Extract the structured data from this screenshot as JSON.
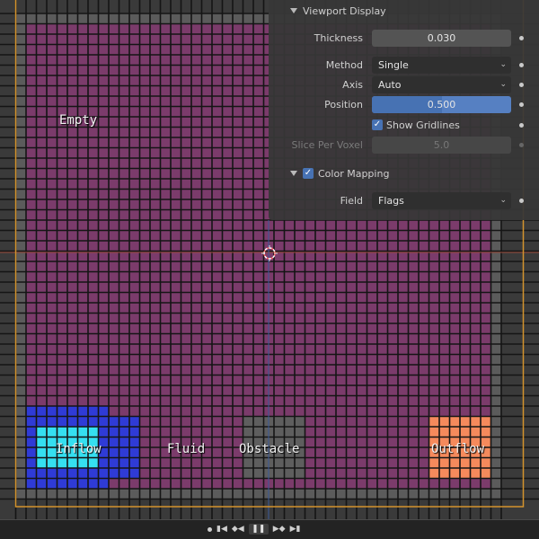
{
  "panel": {
    "title": "Viewport Display",
    "thickness": {
      "label": "Thickness",
      "value": "0.030"
    },
    "method": {
      "label": "Method",
      "value": "Single"
    },
    "axis": {
      "label": "Axis",
      "value": "Auto"
    },
    "position": {
      "label": "Position",
      "value": "0.500",
      "fraction": 0.5
    },
    "show_gridlines": {
      "label": "Show Gridlines",
      "checked": true
    },
    "slice_per_voxel": {
      "label": "Slice Per Voxel",
      "value": "5.0",
      "disabled": true
    },
    "color_mapping": {
      "label": "Color Mapping",
      "checked": true
    },
    "field": {
      "label": "Field",
      "value": "Flags"
    }
  },
  "cell_labels": {
    "empty": "Empty",
    "inflow": "Inflow",
    "fluid": "Fluid",
    "obstacle": "Obstacle",
    "outflow": "Outflow"
  },
  "colors": {
    "empty": "#7b3b6b",
    "fluid": "#7b3b6b",
    "boundary": "#5b5b5b",
    "inflow_outer": "#2f3bd6",
    "inflow_inner": "#35dff0",
    "obstacle": "#5e5e5e",
    "outflow": "#f58a5c",
    "selection_border": "#d4932d"
  },
  "timeline": {
    "icons": [
      "record-dot-icon",
      "jump-start-icon",
      "step-back-icon",
      "pause-icon",
      "step-forward-icon",
      "jump-end-icon"
    ]
  }
}
